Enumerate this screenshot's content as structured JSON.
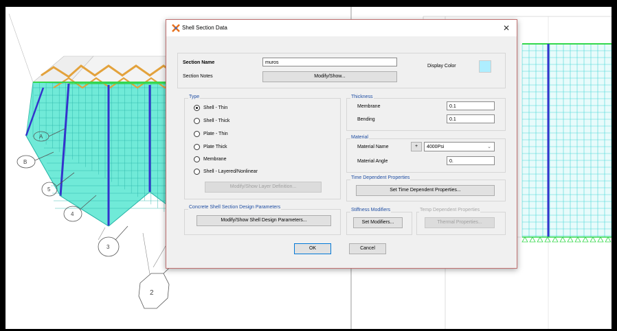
{
  "dialog": {
    "title": "Shell Section Data",
    "close_glyph": "✕",
    "icon": "etabs-app-icon",
    "section_name_label": "Section Name",
    "section_name_value": "muros",
    "section_notes_label": "Section Notes",
    "modify_show_label": "Modify/Show...",
    "display_color_label": "Display Color",
    "display_color": "#aeeeff",
    "type": {
      "title": "Type",
      "options": [
        "Shell - Thin",
        "Shell - Thick",
        "Plate - Thin",
        "Plate Thick",
        "Membrane",
        "Shell - Layered/Nonlinear"
      ],
      "selected": "Shell - Thin",
      "layer_button": "Modify/Show Layer Definition..."
    },
    "thickness": {
      "title": "Thickness",
      "membrane_label": "Membrane",
      "membrane_value": "0.1",
      "bending_label": "Bending",
      "bending_value": "0.1"
    },
    "material": {
      "title": "Material",
      "name_label": "Material Name",
      "plus_label": "+",
      "name_value": "4000Psi",
      "angle_label": "Material Angle",
      "angle_value": "0."
    },
    "time_dependent": {
      "title": "Time Dependent Properties",
      "button": "Set Time Dependent Properties..."
    },
    "concrete": {
      "title": "Concrete Shell Section Design Parameters",
      "button": "Modify/Show Shell Design Parameters..."
    },
    "stiffness": {
      "title": "Stiffness Modifiers",
      "button": "Set Modifiers..."
    },
    "temp": {
      "title": "Temp Dependent Properties",
      "button": "Thermal Properties..."
    },
    "ok_label": "OK",
    "cancel_label": "Cancel"
  },
  "viewport": {
    "grid_bubbles": [
      "A",
      "B",
      "5",
      "4",
      "3",
      "2"
    ],
    "frame_color": "#3333cc",
    "wall_color": "#58e7e0",
    "truss_color": "#e3a23c",
    "slab_color": "#32d84a"
  }
}
